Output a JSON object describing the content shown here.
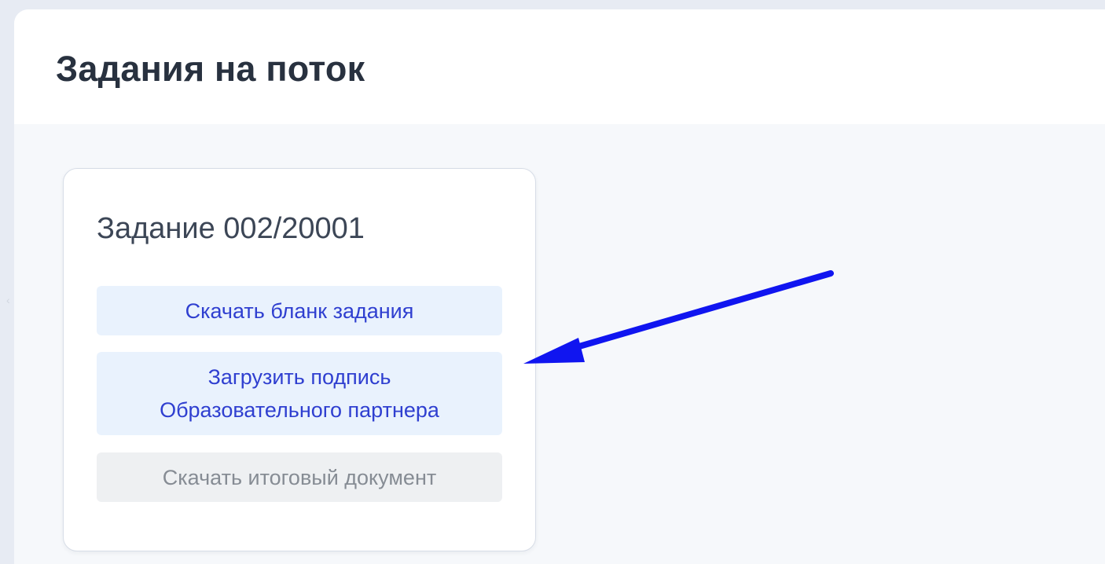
{
  "page": {
    "title": "Задания на поток"
  },
  "task_card": {
    "title": "Задание 002/20001",
    "buttons": {
      "download_blank": "Скачать бланк задания",
      "upload_signature_line1": "Загрузить подпись",
      "upload_signature_line2": "Образовательного партнера",
      "download_final": "Скачать итоговый документ"
    }
  },
  "colors": {
    "primary_text": "#2f3fd0",
    "primary_bg": "#e9f2fd",
    "disabled_text": "#868c94",
    "disabled_bg": "#eef0f2",
    "annotation_arrow": "#1015f0"
  },
  "icons": {
    "left_edge": "chevron-left-icon"
  }
}
